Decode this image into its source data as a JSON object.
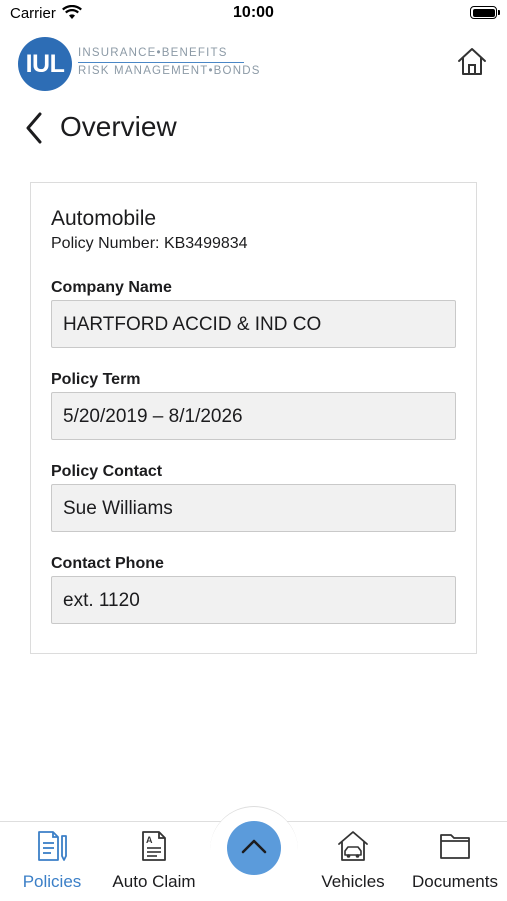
{
  "status_bar": {
    "carrier": "Carrier",
    "time": "10:00"
  },
  "header": {
    "logo_mark": "IUL",
    "logo_line_1": "INSURANCE•BENEFITS",
    "logo_line_2": "RISK MANAGEMENT•BONDS",
    "home_icon": "home-icon",
    "brand_color": "#2d6db5"
  },
  "page": {
    "back_icon": "chevron-left-icon",
    "title": "Overview"
  },
  "policy": {
    "type": "Automobile",
    "number_label": "Policy Number:",
    "number_value": "KB3499834",
    "fields": [
      {
        "label": "Company Name",
        "value": "HARTFORD ACCID & IND CO"
      },
      {
        "label": "Policy Term",
        "value": "5/20/2019 – 8/1/2026"
      },
      {
        "label": "Policy Contact",
        "value": "Sue Williams"
      },
      {
        "label": "Contact Phone",
        "value": "ext. 1120"
      }
    ]
  },
  "tab_bar": {
    "active_color": "#3b7fc7",
    "fab_color": "#5b9bdb",
    "fab_icon": "chevron-up-icon",
    "tabs": [
      {
        "label": "Policies",
        "icon": "policies-icon",
        "active": true
      },
      {
        "label": "Auto Claim",
        "icon": "auto-claim-icon",
        "active": false
      },
      {
        "label": "Vehicles",
        "icon": "vehicles-icon",
        "active": false
      },
      {
        "label": "Documents",
        "icon": "documents-icon",
        "active": false
      }
    ]
  }
}
